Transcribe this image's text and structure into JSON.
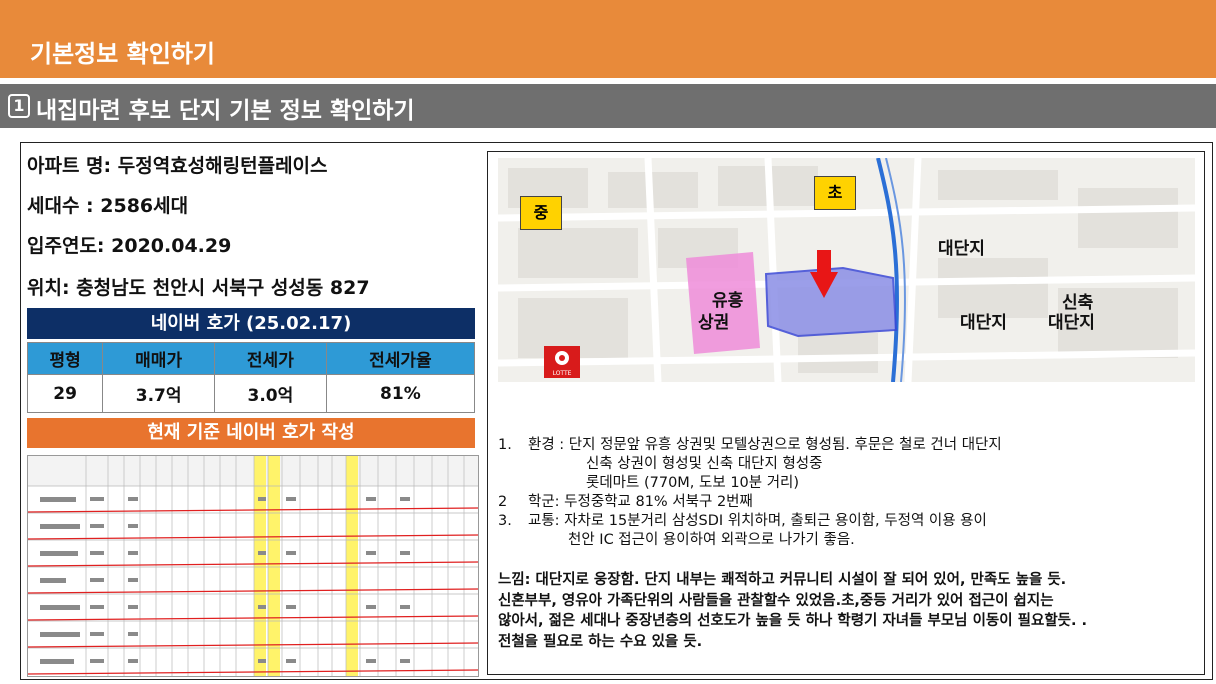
{
  "header": {
    "title": "기본정보 확인하기"
  },
  "section": {
    "number": "1",
    "title": "내집마련 후보 단지 기본 정보 확인하기"
  },
  "info": {
    "apt": "아파트 명: 두정역효성해링턴플레이스",
    "households": "세대수 : 2586세대",
    "move_in": "입주연도:  2020.04.29",
    "location": "위치: 충청남도 천안시 서북구 성성동 827"
  },
  "naver": {
    "title": "네이버 호가 (25.02.17)",
    "headers": [
      "평형",
      "매매가",
      "전세가",
      "전세가율"
    ],
    "values": [
      "29",
      "3.7억",
      "3.0억",
      "81%"
    ]
  },
  "write_bar": "현재 기준 네이버 호가 작성",
  "map": {
    "label_mid": "중",
    "label_elem": "초",
    "label_big1": "대단지",
    "label_big2": "대단지",
    "label_new": "신축\n대단지",
    "label_new_a": "신축",
    "label_new_b": "대단지",
    "label_commerce_a": "유흥",
    "label_commerce_b": "상권"
  },
  "notes": {
    "n1_num": "1.",
    "n1_l1": "환경 : 단지 정문앞 유흥 상권및 모텔상권으로 형성됨. 후문은 철로 건너 대단지",
    "n1_l2": "신축 상권이 형성및 신축 대단지 형성중",
    "n1_l3": "롯데마트 (770M, 도보 10분 거리)",
    "n2_num": "2",
    "n2_l1": "학군: 두정중학교 81% 서북구 2번째",
    "n3_num": "3.",
    "n3_l1": "교통: 자차로 15분거리 삼성SDI 위치하며, 출퇴근 용이함, 두정역 이용 용이",
    "n3_l2": "천안 IC 접근이 용이하여 외곽으로 나가기 좋음.",
    "feel_l1": "느낌: 대단지로 웅장함. 단지 내부는 쾌적하고 커뮤니티 시설이 잘 되어 있어, 만족도 높을 듯.",
    "feel_l2": "신혼부부, 영유아 가족단위의 사람들을 관찰할수 있었음.초,중등 거리가 있어 접근이 쉽지는",
    "feel_l3": "않아서, 젊은 세대나 중장년층의 선호도가 높을 듯 하나 학령기 자녀들 부모님 이동이 필요할듯. .",
    "feel_l4": "전철을 필요로 하는 수요 있을 듯."
  },
  "colors": {
    "orange": "#e88a3a",
    "grey_bar": "#6f6f6f",
    "navy": "#0d2f66",
    "blue_header": "#2e9ad6",
    "orange_bar": "#e8742e",
    "yellow": "#ffd200"
  }
}
